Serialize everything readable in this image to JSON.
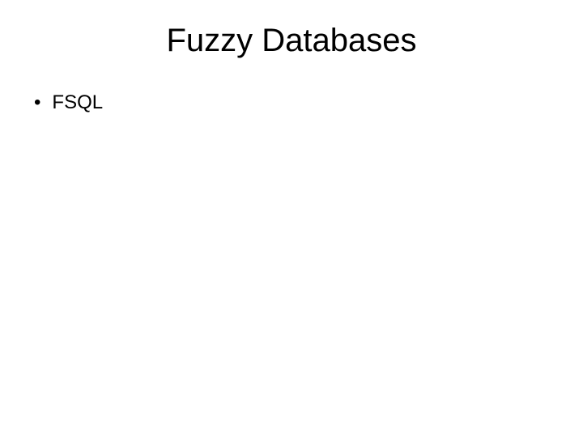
{
  "slide": {
    "title": "Fuzzy Databases",
    "bullets": [
      {
        "text": "FSQL"
      }
    ]
  }
}
